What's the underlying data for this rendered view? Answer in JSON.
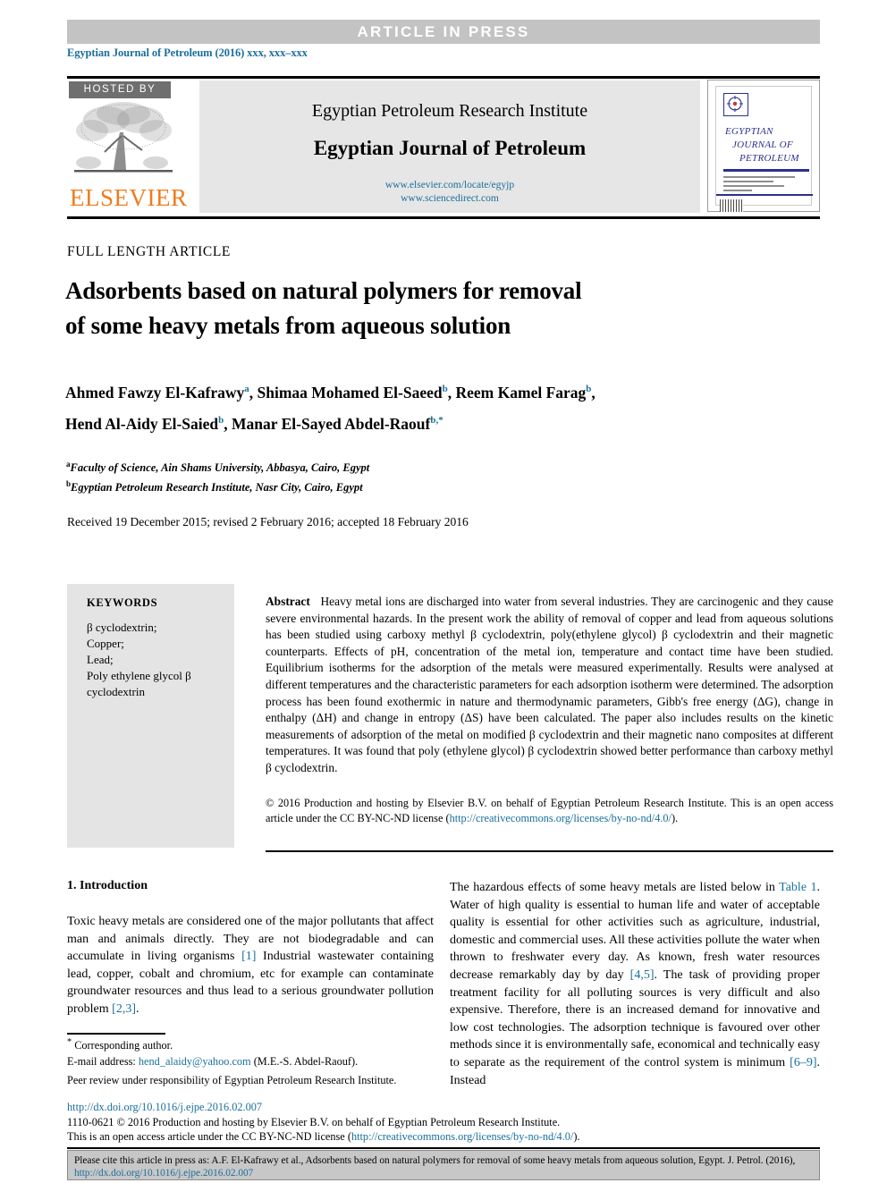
{
  "banner": {
    "label": "ARTICLE IN PRESS"
  },
  "journal_ref": "Egyptian Journal of Petroleum (2016) xxx, xxx–xxx",
  "masthead": {
    "hosted_by": "HOSTED BY",
    "publisher": "ELSEVIER",
    "institute": "Egyptian Petroleum Research Institute",
    "journal_title": "Egyptian Journal of Petroleum",
    "url_locate": "www.elsevier.com/locate/egyjp",
    "url_sciencedirect": "www.sciencedirect.com",
    "cover": {
      "line1": "EGYPTIAN",
      "line2": "JOURNAL OF",
      "line3": "PETROLEUM"
    }
  },
  "article": {
    "type": "FULL LENGTH ARTICLE",
    "title_line1": "Adsorbents based on natural polymers for removal",
    "title_line2": "of some heavy metals from aqueous solution",
    "authors_line1_a": "Ahmed Fawzy El-Kafrawy",
    "authors_line1_a_sup": "a",
    "authors_line1_b": ", Shimaa Mohamed El-Saeed",
    "authors_line1_b_sup": "b",
    "authors_line1_c": ", Reem Kamel Farag",
    "authors_line1_c_sup": "b",
    "authors_line1_end": ",",
    "authors_line2_a": "Hend Al-Aidy El-Saied",
    "authors_line2_a_sup": "b",
    "authors_line2_b": ", Manar El-Sayed Abdel-Raouf",
    "authors_line2_b_sup": "b,",
    "authors_line2_star": "*",
    "affiliation_a_sup": "a",
    "affiliation_a": "Faculty of Science, Ain Shams University, Abbasya, Cairo, Egypt",
    "affiliation_b_sup": "b",
    "affiliation_b": "Egyptian Petroleum Research Institute, Nasr City, Cairo, Egypt",
    "dates": "Received 19 December 2015; revised 2 February 2016; accepted 18 February 2016"
  },
  "keywords": {
    "heading": "KEYWORDS",
    "items": [
      "β cyclodextrin;",
      "Copper;",
      "Lead;",
      "Poly ethylene glycol β",
      "cyclodextrin"
    ]
  },
  "abstract": {
    "label": "Abstract",
    "body": "Heavy metal ions are discharged into water from several industries. They are carcinogenic and they cause severe environmental hazards. In the present work the ability of removal of copper and lead from aqueous solutions has been studied using carboxy methyl β cyclodextrin, poly(ethylene glycol) β cyclodextrin and their magnetic counterparts. Effects of pH, concentration of the metal ion, temperature and contact time have been studied. Equilibrium isotherms for the adsorption of the metals were measured experimentally. Results were analysed at different temperatures and the characteristic parameters for each adsorption isotherm were determined. The adsorption process has been found exothermic in nature and thermodynamic parameters, Gibb's free energy (ΔG), change in enthalpy (ΔH) and change in entropy (ΔS) have been calculated. The paper also includes results on the kinetic measurements of adsorption of the metal on modified β cyclodextrin and their magnetic nano composites at different temperatures. It was found that poly (ethylene glycol) β cyclodextrin showed better performance than carboxy methyl β cyclodextrin.",
    "copyright_line1": "© 2016 Production and hosting by Elsevier B.V. on behalf of Egyptian Petroleum Research Institute. This",
    "copyright_line2_pre": " is an open access article under the CC BY-NC-ND license (",
    "copyright_license_url1": "http://creativecommons.org/licenses/by-no-nd/",
    "copyright_license_url2": "4.0/",
    "copyright_line2_post": ")."
  },
  "introduction": {
    "heading": "1. Introduction",
    "left_paragraph_1": "Toxic heavy metals are considered one of the major pollutants that affect man and animals directly. They are not biodegradable and can accumulate in living organisms ",
    "left_ref_1": "[1]",
    "left_paragraph_2": " Industrial wastewater containing lead, copper, cobalt and chromium, etc for example can contaminate groundwater resources and thus lead to a serious groundwater pollution problem ",
    "left_ref_2": "[2,3]",
    "left_paragraph_3": ".",
    "right_paragraph_1": "The hazardous effects of some heavy metals are listed below in ",
    "right_link_table": "Table 1",
    "right_paragraph_2": ". Water of high quality is essential to human life and water of acceptable quality is essential for other activities such as agriculture, industrial, domestic and commercial uses. All these activities pollute the water when thrown to freshwater every day. As known, fresh water resources decrease remarkably day by day ",
    "right_ref_1": "[4,5]",
    "right_paragraph_3": ". The task of providing proper treatment facility for all polluting sources is very difficult and also expensive. Therefore, there is an increased demand for innovative and low cost technologies. The adsorption technique is favoured over other methods since it is environmentally safe, economical and technically easy to separate as the requirement of the control system is minimum ",
    "right_ref_2": "[6–9]",
    "right_paragraph_4": ". Instead"
  },
  "footnotes": {
    "corresponding_star": "*",
    "corresponding": " Corresponding author.",
    "email_label": "E-mail address: ",
    "email": "hend_alaidy@yahoo.com",
    "email_owner": " (M.E.-S. Abdel-Raouf).",
    "peer_review": "Peer review under responsibility of Egyptian Petroleum Research Institute.",
    "doi": "http://dx.doi.org/10.1016/j.ejpe.2016.02.007",
    "issn_line": "1110-0621 © 2016 Production and hosting by Elsevier B.V. on behalf of Egyptian Petroleum Research Institute.",
    "license_pre": "This is an open access article under the CC BY-NC-ND license (",
    "license_url": "http://creativecommons.org/licenses/by-no-nd/4.0/",
    "license_post": ")."
  },
  "cite_box": {
    "line1": "Please cite this article in press as: A.F. El-Kafrawy et al., Adsorbents based on natural polymers for removal of some heavy metals from aqueous solution, Egypt. J.",
    "line2_pre": "Petrol. (2016), ",
    "line2_link": "http://dx.doi.org/10.1016/j.ejpe.2016.02.007"
  },
  "colors": {
    "link": "#1a6f9c",
    "banner_bg": "#c3c3c3",
    "panel_bg": "#e6e6e6",
    "keywords_bg": "#e4e4e4",
    "elsevier_orange": "#f07c1d",
    "cover_blue": "#2b2f8f"
  }
}
